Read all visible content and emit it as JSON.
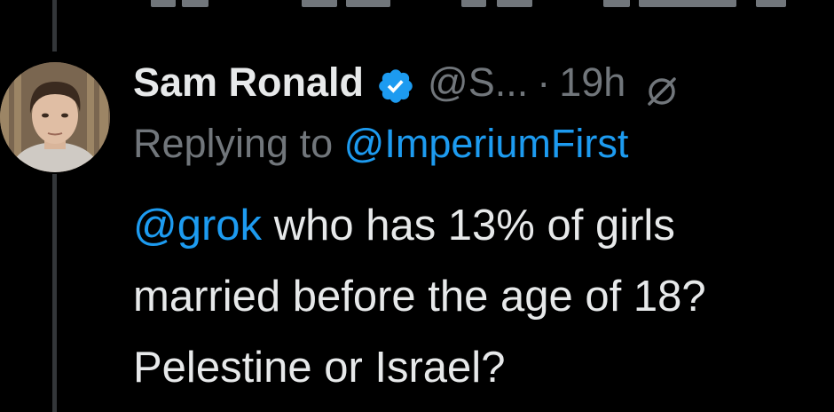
{
  "tweet": {
    "display_name": "Sam Ronald",
    "handle": "@S...",
    "separator": "·",
    "time": "19h",
    "replying_prefix": "Replying to",
    "replying_handle": "@ImperiumFirst",
    "mention": "@grok",
    "body_line_1": "who has 13% of girls",
    "body_line_2": "married before the age of 18?",
    "body_line_3": "Pelestine or Israel?"
  },
  "icons": {
    "verified": "verified-badge-icon",
    "grok": "grok-icon",
    "avatar": "profile-avatar"
  },
  "colors": {
    "background": "#000000",
    "text_primary": "#e7e9ea",
    "text_secondary": "#71767b",
    "accent": "#1d9bf0",
    "thread_line": "#333639"
  }
}
